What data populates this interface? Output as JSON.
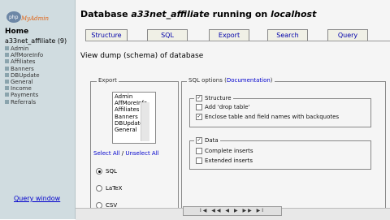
{
  "sidebar": {
    "logo_text": "phpMyAdmin",
    "home_label": "Home",
    "db_label": "a33net_affiliate",
    "db_count": "(9)",
    "tables": [
      "Admin",
      "AffMoreInfo",
      "Affiliates",
      "Banners",
      "DBUpdate",
      "General",
      "Income",
      "Payments",
      "Referrals"
    ],
    "query_window": "Query window"
  },
  "header": {
    "title_prefix": "Database",
    "db_name": "a33net_affiliate",
    "title_suffix": "running on",
    "host": "localhost"
  },
  "tabs": [
    "Structure",
    "SQL",
    "Export",
    "Search",
    "Query"
  ],
  "subtitle": "View dump (schema) of database",
  "export": {
    "legend": "Export",
    "list": [
      "Admin",
      "AffMoreInfo",
      "Affiliates",
      "Banners",
      "DBUpdate",
      "General"
    ],
    "select_all": "Select All",
    "sep": "/",
    "unselect_all": "Unselect All",
    "formats": [
      "SQL",
      "LaTeX",
      "CSV"
    ]
  },
  "sql_options": {
    "legend_prefix": "SQL options (",
    "legend_link": "Documentation",
    "legend_suffix": ")",
    "structure_label": "Structure",
    "add_drop": "Add 'drop table'",
    "enclose": "Enclose table and field names with backquotes",
    "data_label": "Data",
    "complete_inserts": "Complete inserts",
    "extended_inserts": "Extended inserts"
  },
  "player": {
    "controls": "I◀ ◀◀ ◀ ▶ ▶▶ ▶I"
  }
}
